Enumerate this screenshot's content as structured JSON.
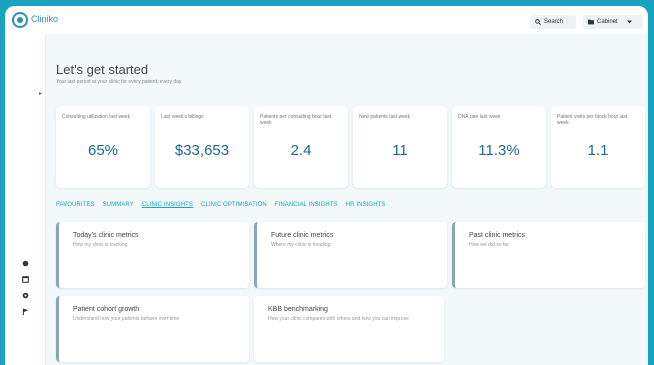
{
  "app": {
    "brand": "Cliniko"
  },
  "header": {
    "search_label": "Search",
    "cabinet_label": "Cabinet"
  },
  "page": {
    "title": "Let's get started",
    "subtitle": "Your last period at your clinic for every patient, every day."
  },
  "metrics": [
    {
      "label": "Consulting utilization last week",
      "value": "65%"
    },
    {
      "label": "Last week's billings",
      "value": "$33,653"
    },
    {
      "label": "Patients per consulting hour last week",
      "value": "2.4"
    },
    {
      "label": "New patients last week",
      "value": "11"
    },
    {
      "label": "DNA rate last week",
      "value": "11.3%"
    },
    {
      "label": "Patient visits per block hour last week",
      "value": "1.1"
    }
  ],
  "tabs": [
    {
      "label": "FAVOURITES",
      "active": false
    },
    {
      "label": "SUMMARY",
      "active": false
    },
    {
      "label": "CLINIC INSIGHTS",
      "active": true
    },
    {
      "label": "CLINIC OPTIMISATION",
      "active": false
    },
    {
      "label": "FINANCIAL INSIGHTS",
      "active": false
    },
    {
      "label": "HR INSIGHTS",
      "active": false
    }
  ],
  "cards": [
    {
      "title": "Today's clinic metrics",
      "desc": "How my clinic is tracking"
    },
    {
      "title": "Future clinic metrics",
      "desc": "Where my clinic is heading"
    },
    {
      "title": "Past clinic metrics",
      "desc": "How we did so far"
    },
    {
      "title": "Patient cohort growth",
      "desc": "Understand how your patients behave over time"
    },
    {
      "title": "KBB benchmarking",
      "desc": "How your clinic compares with others and how you can improve"
    }
  ],
  "colors": {
    "accent": "#1aa3bf",
    "value": "#1f6a86",
    "background": "#1aa3bf"
  }
}
